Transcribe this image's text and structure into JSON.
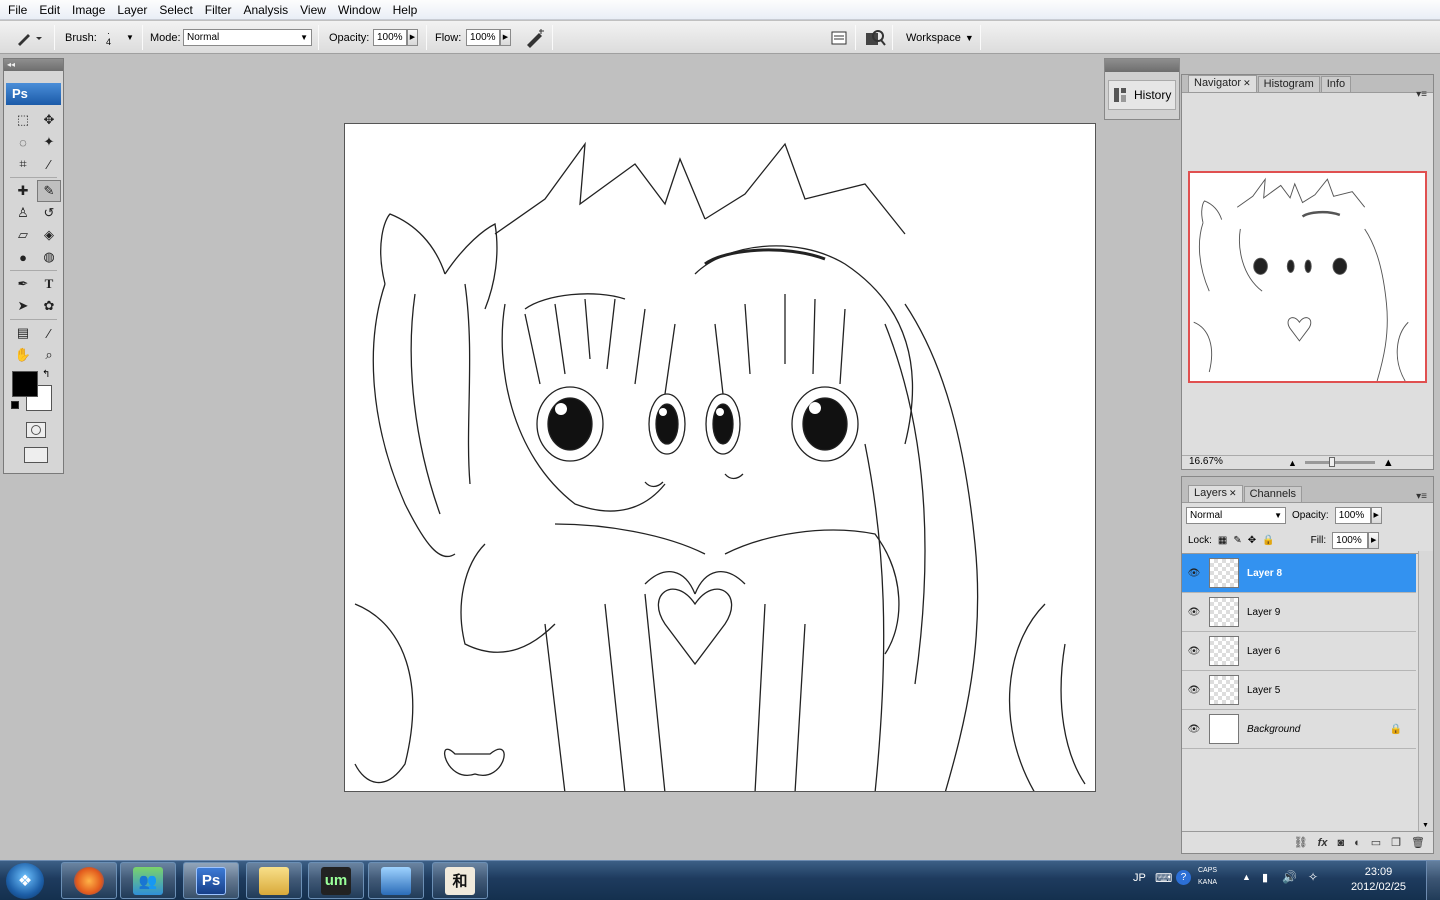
{
  "menu": [
    "File",
    "Edit",
    "Image",
    "Layer",
    "Select",
    "Filter",
    "Analysis",
    "View",
    "Window",
    "Help"
  ],
  "options": {
    "brush_label": "Brush:",
    "brush_size": "4",
    "mode_label": "Mode:",
    "mode_value": "Normal",
    "opacity_label": "Opacity:",
    "opacity_value": "100%",
    "flow_label": "Flow:",
    "flow_value": "100%",
    "workspace_label": "Workspace"
  },
  "toolbox": {
    "logo": "Ps",
    "tools": [
      "marquee-icon",
      "move-icon",
      "lasso-icon",
      "magic-wand-icon",
      "crop-icon",
      "slice-icon",
      "healing-brush-icon",
      "brush-icon",
      "clone-stamp-icon",
      "history-brush-icon",
      "eraser-icon",
      "paint-bucket-icon",
      "blur-icon",
      "dodge-icon",
      "pen-icon",
      "type-icon",
      "path-selection-icon",
      "custom-shape-icon",
      "notes-icon",
      "eyedropper-icon",
      "hand-icon",
      "zoom-icon"
    ],
    "active_tool": "brush-icon",
    "foreground_color": "#000000",
    "background_color": "#ffffff"
  },
  "dock": {
    "history_label": "History"
  },
  "navigator": {
    "tabs": [
      "Navigator",
      "Histogram",
      "Info"
    ],
    "zoom": "16.67%",
    "view_box_color": "#e05050"
  },
  "layers_panel": {
    "tabs": [
      "Layers",
      "Channels"
    ],
    "blend_mode": "Normal",
    "opacity_label": "Opacity:",
    "opacity_value": "100%",
    "lock_label": "Lock:",
    "fill_label": "Fill:",
    "fill_value": "100%",
    "layers": [
      {
        "name": "Layer 8",
        "selected": true
      },
      {
        "name": "Layer 9",
        "selected": false
      },
      {
        "name": "Layer 6",
        "selected": false
      },
      {
        "name": "Layer 5",
        "selected": false
      },
      {
        "name": "Background",
        "selected": false,
        "locked": true
      }
    ],
    "selected_color": "#3392f0"
  },
  "taskbar": {
    "apps": [
      "firefox-icon",
      "messenger-icon",
      "photoshop-icon",
      "explorer-icon",
      "media-icon",
      "pictures-icon",
      "ime-icon"
    ],
    "photoshop_label": "Ps",
    "ime_label": "和",
    "lang": "JP",
    "caps": "CAPS",
    "kana": "KANA",
    "time": "23:09",
    "date": "2012/02/25"
  }
}
